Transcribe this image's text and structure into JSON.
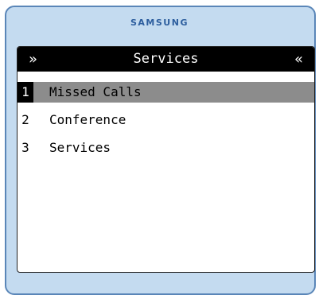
{
  "device": {
    "brand": "SAMSUNG"
  },
  "screen": {
    "title": "Services",
    "left_arrow": "»",
    "right_arrow": "«",
    "menu": [
      {
        "number": "1",
        "label": "Missed Calls",
        "selected": true
      },
      {
        "number": "2",
        "label": "Conference",
        "selected": false
      },
      {
        "number": "3",
        "label": "Services",
        "selected": false
      }
    ]
  },
  "colors": {
    "frame_background": "#c4dbf0",
    "frame_border": "#5a86b8",
    "brand_text": "#2d5e9e",
    "titlebar": "#000000",
    "selected_row": "#8c8c8c"
  },
  "icons": {
    "left_arrow": "double-chevron-right-icon",
    "right_arrow": "double-chevron-left-icon"
  }
}
